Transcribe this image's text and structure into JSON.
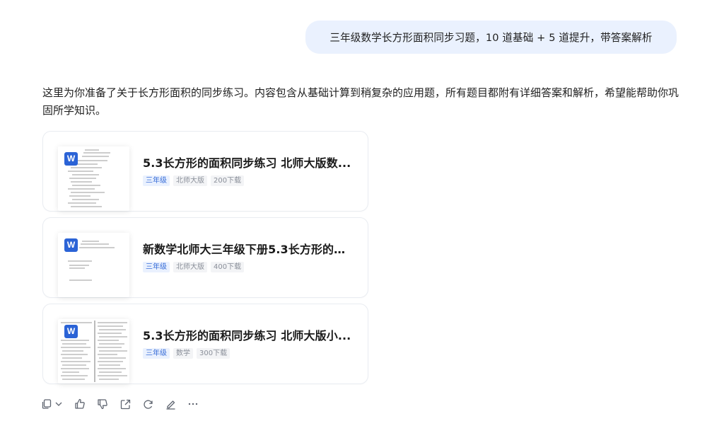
{
  "user_message": "三年级数学长方形面积同步习题，10 道基础 + 5 道提升，带答案解析",
  "reply": {
    "text": "这里为你准备了关于长方形面积的同步练习。内容包含从基础计算到稍复杂的应用题，所有题目都附有详细答案和解析，希望能帮助你巩固所学知识。"
  },
  "documents": [
    {
      "title": "5.3长方形的面积同步练习 北师大版数...",
      "tags": [
        "三年级",
        "北师大版",
        "200下载"
      ],
      "icon": "word-doc-icon"
    },
    {
      "title": "新数学北师大三年级下册5.3长方形的面...",
      "tags": [
        "三年级",
        "北师大版",
        "400下载"
      ],
      "icon": "word-doc-icon"
    },
    {
      "title": "5.3长方形的面积同步练习 北师大版小...",
      "tags": [
        "三年级",
        "数学",
        "300下载"
      ],
      "icon": "word-doc-icon"
    }
  ],
  "action_icons": [
    "copy-icon",
    "chevron-down-icon",
    "thumbs-up-icon",
    "thumbs-down-icon",
    "share-icon",
    "regenerate-icon",
    "edit-icon",
    "more-icon"
  ],
  "colors": {
    "user_bubble_bg": "#eaf1fe",
    "word_icon": "#2b63d6",
    "grade_tag_text": "#3a6fd8",
    "card_border": "#e9ecf1"
  }
}
